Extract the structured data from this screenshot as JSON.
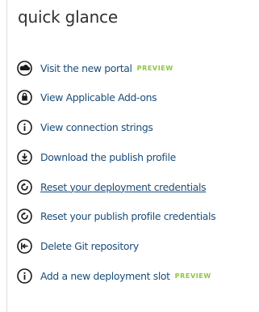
{
  "title": "quick glance",
  "colors": {
    "link": "#1a4d7a",
    "icon": "#1a1a1a",
    "preview_badge": "#8cc63f"
  },
  "items": [
    {
      "label": "Visit the new portal",
      "badge": "PREVIEW",
      "icon": "cloud-icon"
    },
    {
      "label": "View Applicable Add-ons",
      "icon": "shopping-bag-icon"
    },
    {
      "label": "View connection strings",
      "icon": "info-icon"
    },
    {
      "label": "Download the publish profile",
      "icon": "download-icon"
    },
    {
      "label": "Reset your deployment credentials",
      "icon": "reset-icon",
      "hovered": true
    },
    {
      "label": "Reset your publish profile credentials",
      "icon": "reset-icon"
    },
    {
      "label": "Delete Git repository",
      "icon": "git-delete-icon"
    },
    {
      "label": "Add a new deployment slot",
      "badge": "PREVIEW",
      "icon": "info-icon"
    }
  ]
}
